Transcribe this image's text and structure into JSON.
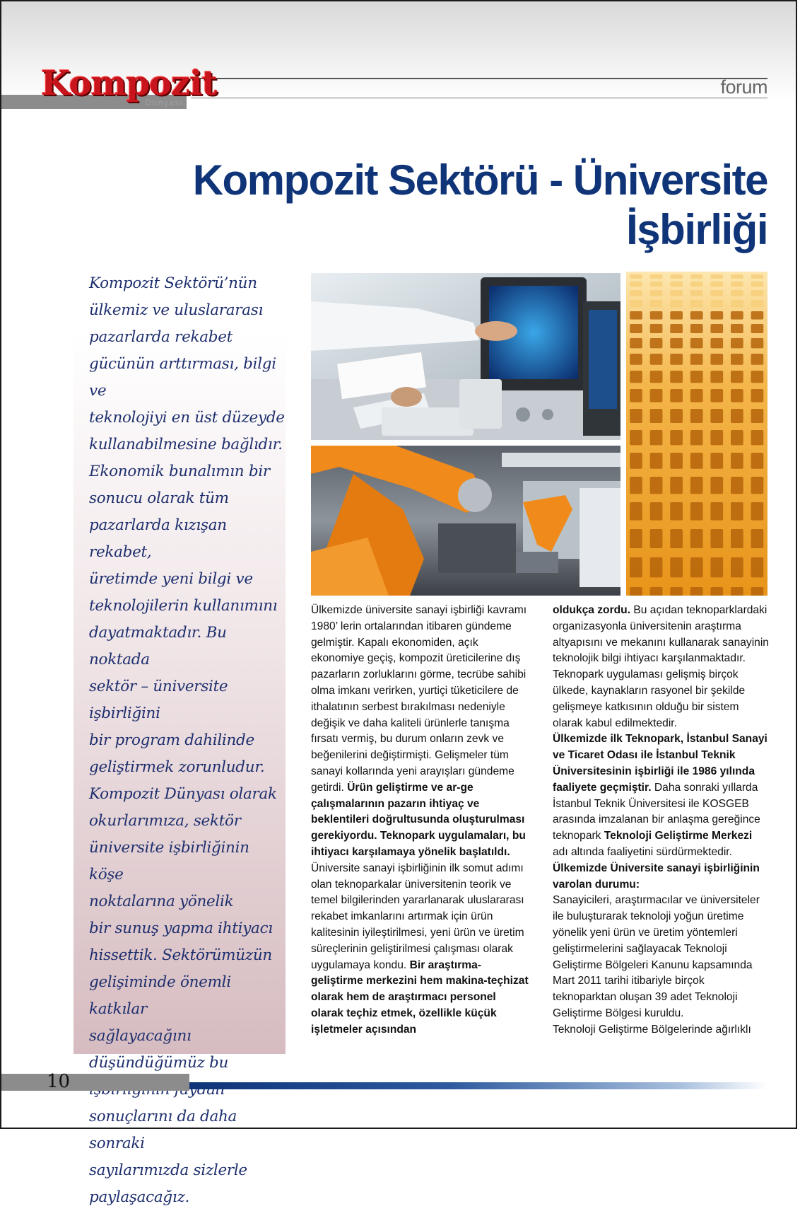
{
  "header": {
    "logo_text": "Kompozit",
    "logo_subtext": "Dünyası",
    "section_label": "forum"
  },
  "article": {
    "title": "Kompozit Sektörü - Üniversite İşbirliği",
    "sidebar_intro": "Kompozit Sektörü’nün\nülkemiz ve uluslararası\npazarlarda rekabet\ngücünün arttırması, bilgi ve\nteknolojiyi en üst düzeyde\nkullanabilmesine bağlıdır.\nEkonomik bunalımın bir\nsonucu olarak tüm\npazarlarda kızışan rekabet,\nüretimde yeni bilgi ve\nteknolojilerin kullanımını\ndayatmaktadır. Bu noktada\nsektör – üniversite işbirliğini\nbir program dahilinde\ngeliştirmek zorunludur.\nKompozit Dünyası olarak\nokurlarımıza, sektör\nüniversite işbirliğinin köşe\nnoktalarına yönelik\nbir sunuş yapma ihtiyacı\nhissettik. Sektörümüzün\ngelişiminde önemli katkılar\nsağlayacağını\ndüşündüğümüz bu\nişbirliğinin faydalı\nsonuçlarını da daha sonraki\nsayılarımızda sizlerle\npaylaşacağız.",
    "col1": {
      "p1": "Ülkemizde üniversite sanayi işbirliği kavramı 1980’ lerin ortalarından itibaren gündeme gelmiştir. Kapalı ekonomiden, açık ekonomiye geçiş, kompozit üreticilerine dış pazarların zorluklarını görme, tecrübe sahibi olma imkanı verirken, yurtiçi tüketicilere de ithalatının serbest bırakılması nedeniyle değişik ve daha kaliteli ürünlerle tanışma fırsatı vermiş, bu durum onların zevk ve beğenilerini değiştirmişti. Gelişmeler tüm sanayi kollarında yeni arayışları gündeme getirdi.",
      "p1_bold": "Ürün geliştirme ve ar-ge çalışmalarının pazarın ihtiyaç ve beklentileri doğrultusunda oluşturulması gerekiyordu. Teknopark uygulamaları, bu ihtiyacı karşılamaya yönelik başlatıldı.",
      "p2": "Üniversite sanayi işbirliğinin ilk somut adımı olan teknoparkalar üniversitenin teorik ve temel bilgilerinden yararlanarak uluslararası rekabet imkanlarını artırmak için ürün kalitesinin iyileştirilmesi, yeni ürün ve üretim süreçlerinin geliştirilmesi çalışması olarak uygulamaya kondu.",
      "p2_bold": "Bir araştırma-geliştirme merkezini hem makina-teçhizat olarak hem de araştırmacı personel olarak teçhiz etmek, özellikle küçük işletmeler açısından"
    },
    "col2": {
      "p1_bold_start": "oldukça zordu.",
      "p1": "Bu açıdan teknoparklardaki organizasyonla üniversitenin araştırma altyapısını ve mekanını kullanarak sanayinin teknolojik bilgi ihtiyacı karşılanmaktadır. Teknopark uygulaması gelişmiş birçok ülkede, kaynakların rasyonel bir şekilde gelişmeye katkısının olduğu bir sistem olarak kabul edilmektedir.",
      "p2_bold": "Ülkemizde ilk Teknopark, İstanbul Sanayi ve Ticaret Odası ile İstanbul Teknik Üniversitesinin işbirliği ile 1986 yılında faaliyete geçmiştir.",
      "p2": "Daha sonraki yıllarda İstanbul Teknik Üniversitesi ile KOSGEB arasında imzalanan bir anlaşma gereğince teknopark",
      "p2_bold_2": "Teknoloji Geliştirme Merkezi",
      "p2_end": "adı altında faaliyetini sürdürmektedir.",
      "h3": "Ülkemizde Üniversite sanayi işbirliğinin varolan durumu:",
      "p3": "Sanayicileri, araştırmacılar ve üniversiteler ile buluşturarak teknoloji yoğun üretime yönelik yeni ürün ve üretim yöntemleri geliştirmelerini sağlayacak Teknoloji Geliştirme Bölgeleri Kanunu kapsamında Mart 2011 tarihi itibariyle birçok teknoparktan oluşan 39 adet Teknoloji Geliştirme Bölgesi kuruldu.",
      "p4": "Teknoloji Geliştirme Bölgelerinde ağırlıklı"
    }
  },
  "footer": {
    "page_number": "10"
  },
  "colors": {
    "title_blue": "#0f3478",
    "logo_red": "#c8141c",
    "sidebar_text": "#1e2f6e",
    "robot_orange": "#f08a1a",
    "grid_orange": "#f0a020"
  },
  "images": {
    "photo_lab": "lab-monitor-photo",
    "photo_robot": "robot-arm-photo",
    "photo_grid": "composite-grating-photo"
  }
}
